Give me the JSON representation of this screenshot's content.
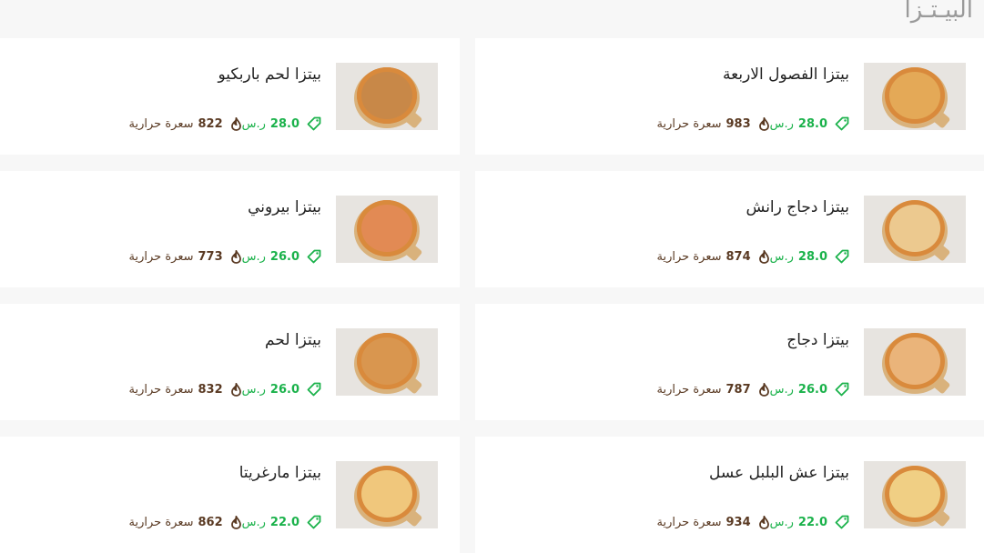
{
  "section_title": "البيـتـزا",
  "currency": "ر.س",
  "calorie_unit": "سعرة حرارية",
  "colors": {
    "price": "#1bb24b",
    "calories": "#5a3a23",
    "title": "#9a9a9a"
  },
  "items": [
    {
      "name": "بيتزا الفصول الاربعة",
      "price": "28.0",
      "calories": "983"
    },
    {
      "name": "بيتزا لحم باربكيو",
      "price": "28.0",
      "calories": "822"
    },
    {
      "name": "بيتزا دجاج رانش",
      "price": "28.0",
      "calories": "874"
    },
    {
      "name": "بيتزا بيروني",
      "price": "26.0",
      "calories": "773"
    },
    {
      "name": "بيتزا دجاج",
      "price": "26.0",
      "calories": "787"
    },
    {
      "name": "بيتزا لحم",
      "price": "26.0",
      "calories": "832"
    },
    {
      "name": "بيتزا عش البلبل عسل",
      "price": "22.0",
      "calories": "934"
    },
    {
      "name": "بيتزا مارغريتا",
      "price": "22.0",
      "calories": "862"
    }
  ]
}
